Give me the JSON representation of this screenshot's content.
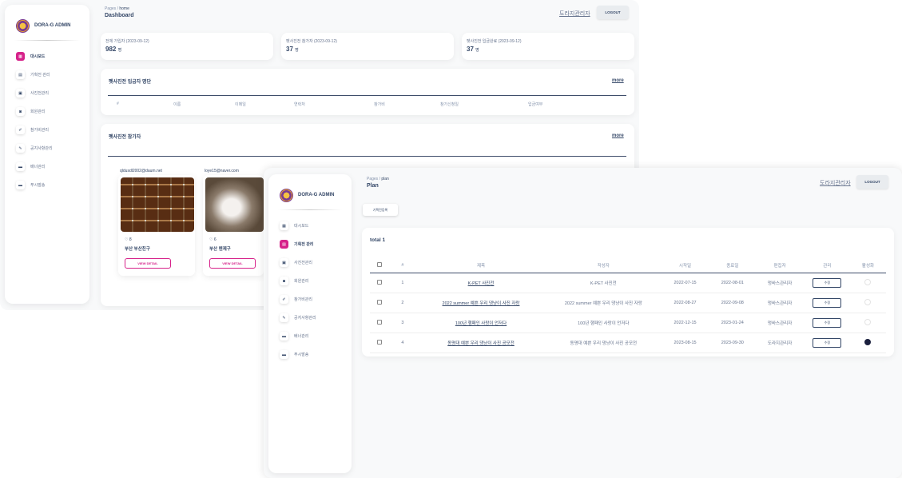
{
  "sidebar": {
    "brand": "DORA-G ADMIN",
    "items": [
      {
        "label": "대시보드",
        "icon": "home-icon"
      },
      {
        "label": "기획전 관리",
        "icon": "document-icon"
      },
      {
        "label": "사진전관리",
        "icon": "image-icon"
      },
      {
        "label": "회원관리",
        "icon": "user-icon"
      },
      {
        "label": "참가비관리",
        "icon": "money-icon"
      },
      {
        "label": "공지사항관리",
        "icon": "megaphone-icon"
      },
      {
        "label": "배너관리",
        "icon": "banner-icon"
      },
      {
        "label": "푸시발송",
        "icon": "push-icon"
      }
    ]
  },
  "dashboard": {
    "breadcrumb_parent": "Pages",
    "breadcrumb_sep": "/",
    "breadcrumb_current": "home",
    "title": "Dashboard",
    "admin_link": "도라지관리자",
    "logout": "LOGOUT",
    "stats": [
      {
        "label": "전체 가입자 (2023-09-12)",
        "value": "982",
        "unit": "명"
      },
      {
        "label": "펫사진전 참가자 (2023-09-12)",
        "value": "37",
        "unit": "명"
      },
      {
        "label": "펫사진전 입금완료 (2023-09-12)",
        "value": "37",
        "unit": "명"
      }
    ],
    "payment_section": {
      "title": "펫사진전 입금자 명단",
      "more": "more",
      "columns": [
        "#",
        "이름",
        "이메일",
        "연락처",
        "참가비",
        "참가신청일",
        "입금여부"
      ]
    },
    "participants_section": {
      "title": "펫사진전 참가자",
      "more": "more",
      "cards": [
        {
          "email": "qldusdl2002@daum.net",
          "likes": "8",
          "name": "부산 부산친구",
          "button": "VIEW DETAIL"
        },
        {
          "email": "loye15@naver.com",
          "likes": "6",
          "name": "부산 멘제구",
          "button": "VIEW DETAIL"
        }
      ]
    }
  },
  "plan": {
    "breadcrumb_parent": "Pages",
    "breadcrumb_sep": "/",
    "breadcrumb_current": "plan",
    "title": "Plan",
    "admin_link": "도라지관리자",
    "logout": "LOGOUT",
    "register_button": "기획전등록",
    "total": "total 1",
    "columns": [
      "#",
      "제목",
      "작성자",
      "시작일",
      "종료일",
      "편집자",
      "관리",
      "활성화"
    ],
    "edit_label": "수정",
    "rows": [
      {
        "num": "1",
        "title": "K-PET 사진전",
        "author": "K-PET 사진전",
        "start": "2022-07-15",
        "end": "2022-08-01",
        "editor": "멍바스관리자",
        "active": false
      },
      {
        "num": "2",
        "title": "2022 summer 예쁜 우리 댕냥이 사진 자랑",
        "author": "2022 summer 예쁜 우리 댕냥이 사진 자랑",
        "start": "2022-08-27",
        "end": "2022-09-08",
        "editor": "멍바스관리자",
        "active": false
      },
      {
        "num": "3",
        "title": "100년 행패인 사랑이 언저다",
        "author": "100년 행패인 사랑이 언저다",
        "start": "2022-12-15",
        "end": "2023-01-24",
        "editor": "멍바스관리자",
        "active": false
      },
      {
        "num": "4",
        "title": "동명대 예쁜 우리 댕냥이 사진 공모전",
        "author": "동명대 예쁜 우리 댕냥이 사진 공모전",
        "start": "2023-08-15",
        "end": "2023-09-30",
        "editor": "도라지관리자",
        "active": true
      }
    ]
  }
}
